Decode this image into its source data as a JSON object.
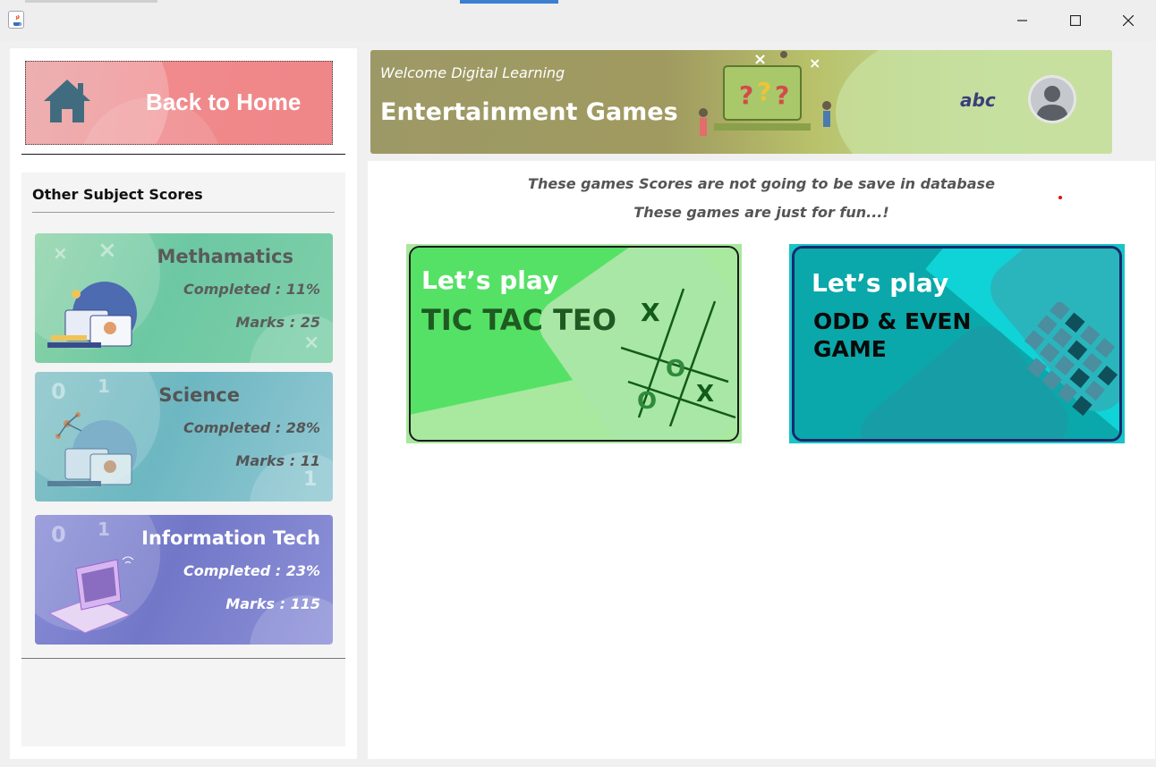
{
  "window": {
    "controls": [
      "minimize",
      "maximize",
      "close"
    ]
  },
  "sidebar": {
    "home_button_label": "Back to Home",
    "scores_title": "Other Subject Scores",
    "subjects": [
      {
        "name": "Methamatics",
        "completed": "Completed : 11%",
        "marks": "Marks : 25",
        "color": "#6cc8a3"
      },
      {
        "name": "Science",
        "completed": "Completed : 28%",
        "marks": "Marks : 11",
        "color": "#6db7c2"
      },
      {
        "name": "Information Tech",
        "completed": "Completed : 23%",
        "marks": "Marks : 115",
        "color": "#7277c8"
      }
    ]
  },
  "header": {
    "subtitle": "Welcome Digital Learning",
    "title": "Entertainment Games",
    "username": "abc"
  },
  "main": {
    "notice_line1": "These games Scores are not going to be save in database",
    "notice_line2": "These games are just for fun...!",
    "games": [
      {
        "lets_play": "Let’s play",
        "title": "TIC TAC TEO",
        "color": "#55e165"
      },
      {
        "lets_play": "Let’s play",
        "title": "ODD & EVEN\nGAME",
        "color": "#19c3c7"
      }
    ]
  },
  "colors": {
    "home_button": "#f08a8c",
    "banner": "#a09a60",
    "accent": "#3a7fd0"
  }
}
